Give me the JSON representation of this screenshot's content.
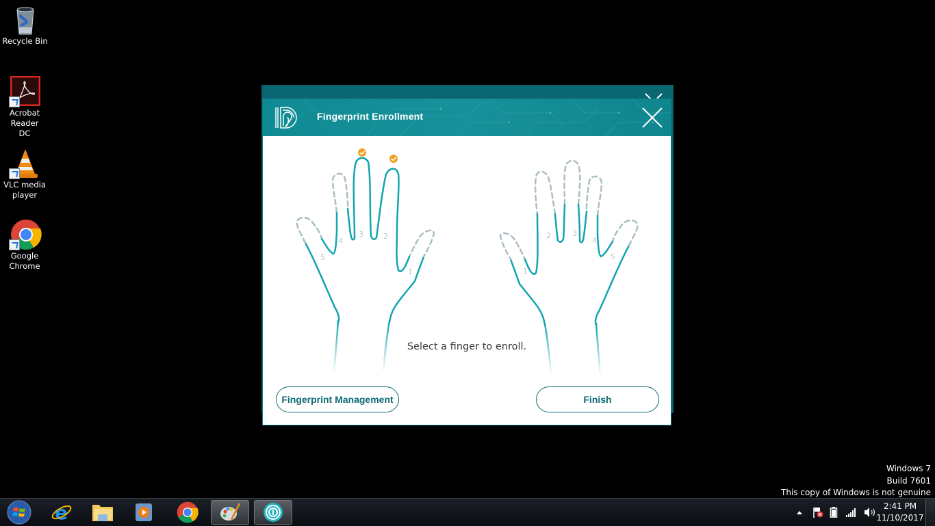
{
  "desktop": {
    "icons": [
      {
        "label": "Recycle Bin",
        "icon": "recycle-bin-icon"
      },
      {
        "label": "Acrobat Reader DC",
        "icon": "acrobat-icon"
      },
      {
        "label": "VLC media player",
        "icon": "vlc-icon"
      },
      {
        "label": "Google Chrome",
        "icon": "chrome-icon"
      }
    ]
  },
  "dialog": {
    "title": "Fingerprint Enrollment",
    "prompt": "Select a finger to enroll.",
    "buttons": {
      "management": "Fingerprint Management",
      "finish": "Finish"
    },
    "left_hand": {
      "fingers": [
        {
          "number": "1",
          "enrolled": false
        },
        {
          "number": "2",
          "enrolled": true
        },
        {
          "number": "3",
          "enrolled": true
        },
        {
          "number": "4",
          "enrolled": false
        },
        {
          "number": "5",
          "enrolled": false
        }
      ]
    },
    "right_hand": {
      "fingers": [
        {
          "number": "1",
          "enrolled": false
        },
        {
          "number": "2",
          "enrolled": false
        },
        {
          "number": "3",
          "enrolled": false
        },
        {
          "number": "4",
          "enrolled": false
        },
        {
          "number": "5",
          "enrolled": false
        }
      ]
    },
    "colors": {
      "accent": "#12a5ad",
      "dashed": "#a9bfc2",
      "check": "#f0a020",
      "title_bar": "#138c95",
      "button_text": "#0e6b74"
    }
  },
  "watermark": {
    "line1": "Windows 7",
    "line2": "Build 7601",
    "line3": "This copy of Windows is not genuine"
  },
  "taskbar": {
    "items": [
      {
        "icon": "start-orb-icon"
      },
      {
        "icon": "internet-explorer-icon"
      },
      {
        "icon": "file-explorer-icon"
      },
      {
        "icon": "media-player-icon"
      },
      {
        "icon": "chrome-icon"
      },
      {
        "icon": "paint-icon"
      },
      {
        "icon": "fingerprint-app-icon"
      }
    ],
    "clock": {
      "time": "2:41 PM",
      "date": "11/10/2017"
    }
  }
}
